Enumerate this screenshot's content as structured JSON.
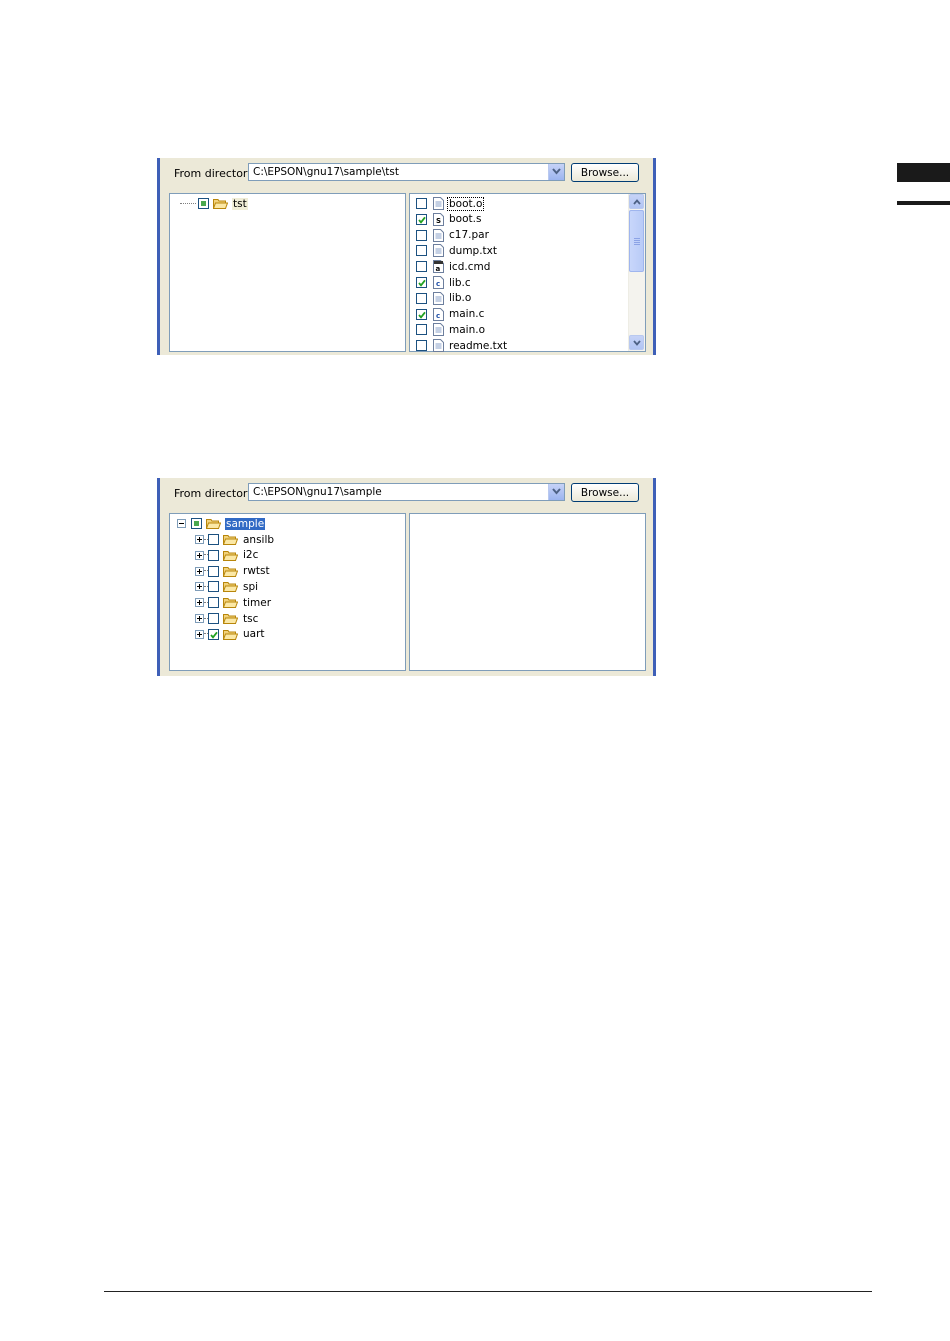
{
  "dialog_top": {
    "from_label": "From directory:",
    "path": "C:\\EPSON\\gnu17\\sample\\tst",
    "browse_label": "Browse...",
    "tree": [
      {
        "label": "tst",
        "state": "partial"
      }
    ],
    "files": [
      {
        "label": "boot.o",
        "checked": false,
        "icon": "generic-file-icon"
      },
      {
        "label": "boot.s",
        "checked": true,
        "icon": "s-file-icon"
      },
      {
        "label": "c17.par",
        "checked": false,
        "icon": "generic-file-icon"
      },
      {
        "label": "dump.txt",
        "checked": false,
        "icon": "generic-file-icon"
      },
      {
        "label": "icd.cmd",
        "checked": false,
        "icon": "cmd-file-icon"
      },
      {
        "label": "lib.c",
        "checked": true,
        "icon": "c-file-icon"
      },
      {
        "label": "lib.o",
        "checked": false,
        "icon": "generic-file-icon"
      },
      {
        "label": "main.c",
        "checked": true,
        "icon": "c-file-icon"
      },
      {
        "label": "main.o",
        "checked": false,
        "icon": "generic-file-icon"
      },
      {
        "label": "readme.txt",
        "checked": false,
        "icon": "generic-file-icon"
      }
    ]
  },
  "dialog_bottom": {
    "from_label": "From directory:",
    "path": "C:\\EPSON\\gnu17\\sample",
    "browse_label": "Browse...",
    "root": {
      "label": "sample",
      "state": "partial"
    },
    "children": [
      {
        "label": "ansilb",
        "checked": false
      },
      {
        "label": "i2c",
        "checked": false
      },
      {
        "label": "rwtst",
        "checked": false
      },
      {
        "label": "spi",
        "checked": false
      },
      {
        "label": "timer",
        "checked": false
      },
      {
        "label": "tsc",
        "checked": false
      },
      {
        "label": "uart",
        "checked": true
      }
    ]
  },
  "colors": {
    "panel_bg": "#ece9d8",
    "panel_border": "#3e5fb7",
    "selection": "#316ac5",
    "check_green": "#21a121"
  }
}
